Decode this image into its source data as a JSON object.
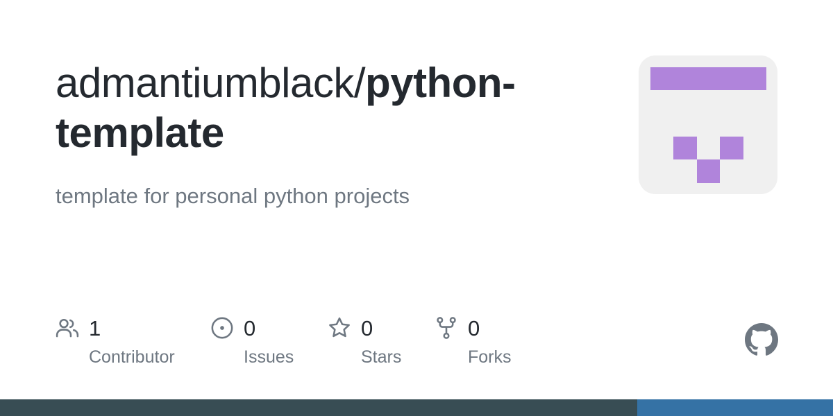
{
  "repo": {
    "owner": "admantiumblack/",
    "name": "python-template",
    "description": "template for personal python projects"
  },
  "stats": {
    "contributors": {
      "count": "1",
      "label": "Contributor",
      "icon": "people-icon"
    },
    "issues": {
      "count": "0",
      "label": "Issues",
      "icon": "issue-opened-icon"
    },
    "stars": {
      "count": "0",
      "label": "Stars",
      "icon": "star-icon"
    },
    "forks": {
      "count": "0",
      "label": "Forks",
      "icon": "repo-forked-icon"
    }
  },
  "colors": {
    "text_primary": "#24292f",
    "text_secondary": "#6e7781",
    "avatar_background": "#f0f0f0",
    "avatar_foreground": "#b084db",
    "bar_segment_1": "#384d54",
    "bar_segment_2": "#3572a5"
  },
  "language_bar": [
    {
      "color": "#384d54",
      "fraction": 0.765
    },
    {
      "color": "#3572a5",
      "fraction": 0.235
    }
  ]
}
